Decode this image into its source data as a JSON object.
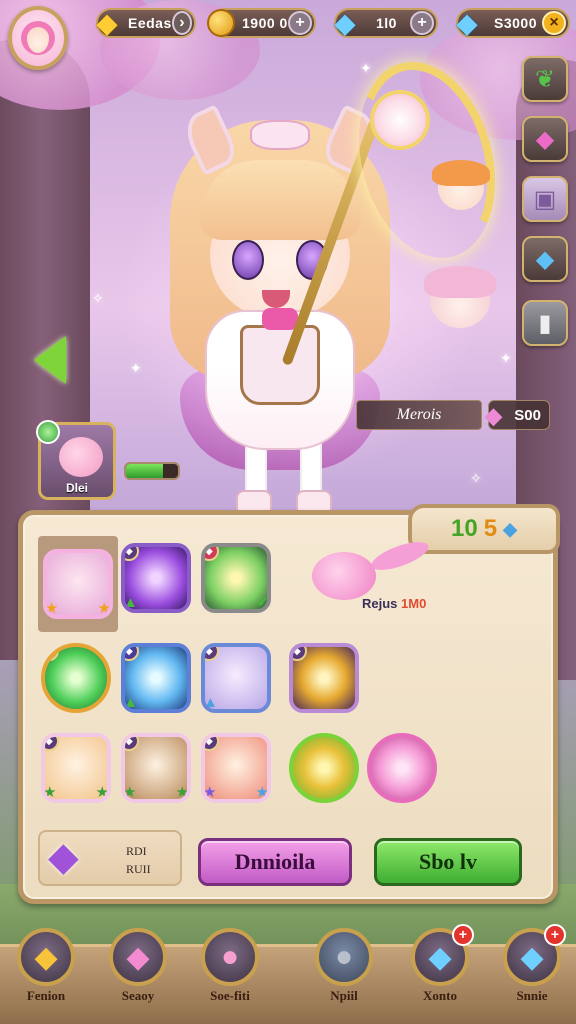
{
  "hud": {
    "resources": [
      {
        "name": "stars",
        "value": "Eedas",
        "icon": "star-gem-icon"
      },
      {
        "name": "coins",
        "value": "1900 0",
        "icon": "coin-icon"
      },
      {
        "name": "crystals",
        "value": "1l0",
        "icon": "crystal-icon"
      },
      {
        "name": "gems",
        "value": "S3000",
        "icon": "gem-icon"
      }
    ]
  },
  "side_menu": [
    {
      "name": "leaf",
      "icon": "leaf-icon"
    },
    {
      "name": "shard",
      "icon": "pink-shard-icon"
    },
    {
      "name": "chest",
      "icon": "chest-icon"
    },
    {
      "name": "crystal",
      "icon": "blue-crystal-icon"
    },
    {
      "name": "tool",
      "icon": "tool-icon"
    }
  ],
  "character": {
    "name": "Merois",
    "power": "S00"
  },
  "pet": {
    "label": "Dlei",
    "hp_fraction": 0.72
  },
  "panel": {
    "counter_a": "10",
    "counter_b": "5",
    "pet_caption": "Rejus",
    "pet_level": "1M0",
    "slots": [
      {
        "kind": "portrait",
        "theme": "pink-hair"
      },
      {
        "kind": "orb",
        "theme": "purple"
      },
      {
        "kind": "gem",
        "theme": "green"
      },
      {
        "kind": "gem",
        "theme": "green-orb"
      },
      {
        "kind": "gem",
        "theme": "blue-crystal"
      },
      {
        "kind": "portrait",
        "theme": "lilac-cat"
      },
      {
        "kind": "gem",
        "theme": "gold-shard"
      },
      {
        "kind": "portrait",
        "theme": "blonde"
      },
      {
        "kind": "portrait",
        "theme": "brunette"
      },
      {
        "kind": "portrait",
        "theme": "redhead"
      },
      {
        "kind": "token",
        "theme": "gold-gem"
      },
      {
        "kind": "token",
        "theme": "pink-pet"
      }
    ],
    "craft_line1": "RDI",
    "craft_line2": "RUII",
    "btn_primary": "Dnnioila",
    "btn_secondary": "Sbo lv"
  },
  "bottom_nav": [
    {
      "label": "Fenion",
      "icon": "gold-gem-icon",
      "notif": ""
    },
    {
      "label": "Seaoy",
      "icon": "pink-crystal-icon",
      "notif": ""
    },
    {
      "label": "Soe-fiti",
      "icon": "pink-cat-icon",
      "notif": ""
    },
    {
      "label": "Npiil",
      "icon": "gray-pet-icon",
      "notif": ""
    },
    {
      "label": "Xonto",
      "icon": "blue-gem-icon",
      "notif": "+"
    },
    {
      "label": "Snnie",
      "icon": "blue-crystal-icon",
      "notif": "+"
    }
  ]
}
